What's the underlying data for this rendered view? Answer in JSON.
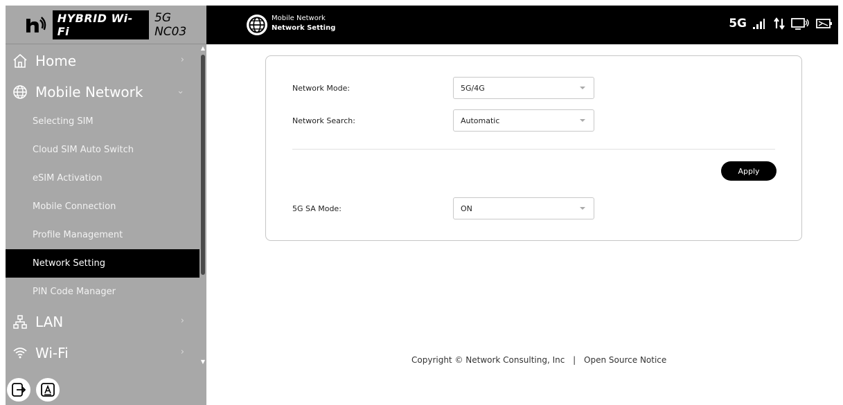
{
  "brand": {
    "badge": "HYBRID Wi-Fi",
    "model": "5G NC03"
  },
  "header": {
    "section": "Mobile Network",
    "page": "Network Setting",
    "network_type": "5G"
  },
  "sidebar": {
    "items": [
      {
        "label": "Home",
        "icon": "home-icon",
        "chevron": "›"
      },
      {
        "label": "Mobile Network",
        "icon": "globe-icon",
        "chevron": "⌄"
      }
    ],
    "sub_items": [
      {
        "label": "Selecting SIM"
      },
      {
        "label": "Cloud SIM Auto Switch"
      },
      {
        "label": "eSIM Activation"
      },
      {
        "label": "Mobile Connection"
      },
      {
        "label": "Profile Management"
      },
      {
        "label": "Network Setting",
        "active": true
      },
      {
        "label": "PIN Code Manager"
      }
    ],
    "items_after": [
      {
        "label": "LAN",
        "icon": "lan-icon",
        "chevron": "›"
      },
      {
        "label": "Wi-Fi",
        "icon": "wifi-icon",
        "chevron": "›"
      }
    ]
  },
  "form": {
    "network_mode": {
      "label": "Network Mode:",
      "value": "5G/4G"
    },
    "network_search": {
      "label": "Network Search:",
      "value": "Automatic"
    },
    "apply_label": "Apply",
    "sa_mode": {
      "label": "5G SA Mode:",
      "value": "ON"
    }
  },
  "footer": {
    "copyright": "Copyright © Network Consulting, Inc",
    "separator": "|",
    "link": "Open Source Notice"
  },
  "colors": {
    "sidebar_bg": "#a8a8a8",
    "header_bg": "#000000",
    "active_item_bg": "#000000",
    "button_bg": "#000000"
  }
}
